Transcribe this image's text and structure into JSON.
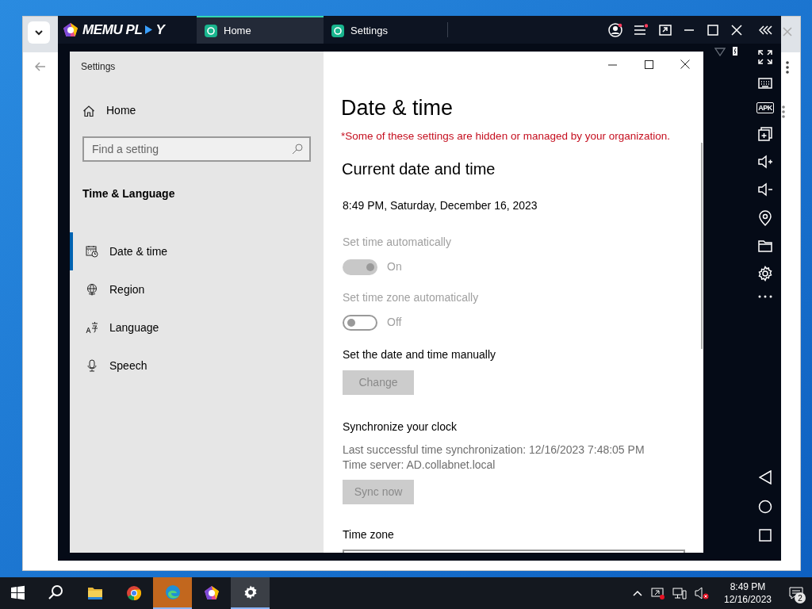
{
  "emulator": {
    "brand_parts": [
      "MEMU PL",
      "Y"
    ],
    "tabs": [
      {
        "label": "Home",
        "selected": true
      },
      {
        "label": "Settings",
        "selected": false
      }
    ],
    "apk_label": "APK"
  },
  "window": {
    "title": "Settings"
  },
  "sidebar": {
    "home": "Home",
    "search": {
      "placeholder": "Find a setting"
    },
    "section": "Time & Language",
    "items": [
      {
        "label": "Date & time",
        "selected": true,
        "kind": "calendar"
      },
      {
        "label": "Region",
        "selected": false,
        "kind": "globe"
      },
      {
        "label": "Language",
        "selected": false,
        "kind": "language"
      },
      {
        "label": "Speech",
        "selected": false,
        "kind": "microphone"
      }
    ]
  },
  "page": {
    "title": "Date & time",
    "notice": "*Some of these settings are hidden or managed by your organization.",
    "section": "Current date and time",
    "current": "8:49 PM, Saturday, December 16, 2023",
    "toggles": [
      {
        "label": "Set time automatically",
        "on": true,
        "disabled": true,
        "state_text": "On"
      },
      {
        "label": "Set time zone automatically",
        "on": false,
        "disabled": true,
        "state_text": "Off"
      }
    ],
    "manual": {
      "label": "Set the date and time manually",
      "button": "Change",
      "disabled": true
    },
    "sync": {
      "heading": "Synchronize your clock",
      "lines": [
        "Last successful time synchronization: 12/16/2023 7:48:05 PM",
        "Time server: AD.collabnet.local"
      ],
      "button": "Sync now",
      "disabled": true
    },
    "timezone": {
      "label": "Time zone"
    }
  },
  "taskbar": {
    "apps": [
      {
        "kind": "start",
        "flashing": false,
        "open": false
      },
      {
        "kind": "search",
        "flashing": false,
        "open": false
      },
      {
        "kind": "folder",
        "flashing": false,
        "open": false
      },
      {
        "kind": "chrome",
        "flashing": false,
        "open": false
      },
      {
        "kind": "edge",
        "flashing": true,
        "open": true
      },
      {
        "kind": "memu",
        "flashing": false,
        "open": false
      },
      {
        "kind": "settings",
        "flashing": false,
        "open": true
      }
    ],
    "time": "8:49 PM",
    "date": "12/16/2023",
    "notifications": "2"
  }
}
